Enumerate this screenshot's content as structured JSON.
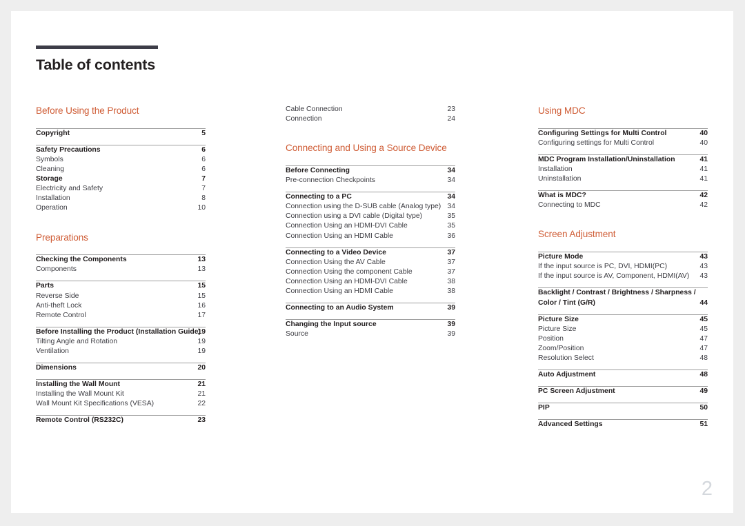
{
  "document": {
    "title": "Table of contents",
    "folio": "2",
    "accent_color": "#cf5c35",
    "rule_color": "#9d9d9d",
    "title_bar_color": "#3d3d48",
    "folio_color": "#d4d8dd"
  },
  "columns": [
    {
      "name": "column-1",
      "blocks": [
        {
          "type": "section-title",
          "text": "Before Using the Product"
        },
        {
          "type": "group",
          "ruled": true,
          "entries": [
            {
              "style": "head",
              "label": "Copyright",
              "page": "5"
            }
          ]
        },
        {
          "type": "spacer",
          "size": "sm"
        },
        {
          "type": "group",
          "ruled": true,
          "entries": [
            {
              "style": "head",
              "label": "Safety Precautions",
              "page": "6"
            },
            {
              "style": "sub",
              "label": "Symbols",
              "page": "6"
            },
            {
              "style": "sub",
              "label": "Cleaning",
              "page": "6"
            },
            {
              "style": "sub bold",
              "label": "Storage",
              "page": "7"
            },
            {
              "style": "sub",
              "label": "Electricity and Safety",
              "page": "7"
            },
            {
              "style": "sub",
              "label": "Installation",
              "page": "8"
            },
            {
              "style": "sub",
              "label": "Operation",
              "page": "10"
            }
          ]
        },
        {
          "type": "spacer",
          "size": "lg"
        },
        {
          "type": "section-title",
          "text": "Preparations"
        },
        {
          "type": "group",
          "ruled": true,
          "entries": [
            {
              "style": "head",
              "label": "Checking the Components",
              "page": "13"
            },
            {
              "style": "sub",
              "label": "Components",
              "page": "13"
            }
          ]
        },
        {
          "type": "spacer",
          "size": "sm"
        },
        {
          "type": "group",
          "ruled": true,
          "entries": [
            {
              "style": "head",
              "label": "Parts",
              "page": "15"
            },
            {
              "style": "sub",
              "label": "Reverse Side",
              "page": "15"
            },
            {
              "style": "sub",
              "label": "Anti-theft Lock",
              "page": "16"
            },
            {
              "style": "sub",
              "label": "Remote Control",
              "page": "17"
            }
          ]
        },
        {
          "type": "spacer",
          "size": "sm"
        },
        {
          "type": "group",
          "ruled": true,
          "entries": [
            {
              "style": "head wrap",
              "label": "Before Installing the Product (Installation Guide)",
              "page": "19"
            },
            {
              "style": "sub",
              "label": "Tilting Angle and Rotation",
              "page": "19"
            },
            {
              "style": "sub",
              "label": "Ventilation",
              "page": "19"
            }
          ]
        },
        {
          "type": "spacer",
          "size": "sm"
        },
        {
          "type": "group",
          "ruled": true,
          "entries": [
            {
              "style": "head",
              "label": "Dimensions",
              "page": "20"
            }
          ]
        },
        {
          "type": "spacer",
          "size": "sm"
        },
        {
          "type": "group",
          "ruled": true,
          "entries": [
            {
              "style": "head",
              "label": "Installing the Wall Mount",
              "page": "21"
            },
            {
              "style": "sub",
              "label": "Installing the Wall Mount Kit",
              "page": "21"
            },
            {
              "style": "sub",
              "label": "Wall Mount Kit Specifications (VESA)",
              "page": "22"
            }
          ]
        },
        {
          "type": "spacer",
          "size": "sm"
        },
        {
          "type": "group",
          "ruled": true,
          "entries": [
            {
              "style": "head",
              "label": "Remote Control (RS232C)",
              "page": "23"
            }
          ]
        }
      ]
    },
    {
      "name": "column-2",
      "blocks": [
        {
          "type": "group",
          "ruled": false,
          "entries": [
            {
              "style": "sub",
              "label": "Cable Connection",
              "page": "23"
            },
            {
              "style": "sub",
              "label": "Connection",
              "page": "24"
            }
          ]
        },
        {
          "type": "spacer",
          "size": "lg"
        },
        {
          "type": "section-title",
          "text": "Connecting and Using a Source Device"
        },
        {
          "type": "group",
          "ruled": true,
          "entries": [
            {
              "style": "head",
              "label": "Before Connecting",
              "page": "34"
            },
            {
              "style": "sub",
              "label": "Pre-connection Checkpoints",
              "page": "34"
            }
          ]
        },
        {
          "type": "spacer",
          "size": "sm"
        },
        {
          "type": "group",
          "ruled": true,
          "entries": [
            {
              "style": "head",
              "label": "Connecting to a PC",
              "page": "34"
            },
            {
              "style": "sub wrap",
              "label": "Connection using the D-SUB cable (Analog type)",
              "page": "34"
            },
            {
              "style": "sub",
              "label": "Connection using a DVI cable (Digital type)",
              "page": "35"
            },
            {
              "style": "sub",
              "label": "Connection Using an HDMI-DVI Cable",
              "page": "35"
            },
            {
              "style": "sub",
              "label": "Connection Using an HDMI Cable",
              "page": "36"
            }
          ]
        },
        {
          "type": "spacer",
          "size": "sm"
        },
        {
          "type": "group",
          "ruled": true,
          "entries": [
            {
              "style": "head",
              "label": "Connecting to a Video Device",
              "page": "37"
            },
            {
              "style": "sub",
              "label": "Connection Using the AV Cable",
              "page": "37"
            },
            {
              "style": "sub",
              "label": "Connection Using the component Cable",
              "page": "37"
            },
            {
              "style": "sub",
              "label": "Connection Using an HDMI-DVI Cable",
              "page": "38"
            },
            {
              "style": "sub",
              "label": "Connection Using an HDMI Cable",
              "page": "38"
            }
          ]
        },
        {
          "type": "spacer",
          "size": "sm"
        },
        {
          "type": "group",
          "ruled": true,
          "entries": [
            {
              "style": "head",
              "label": "Connecting to an Audio System",
              "page": "39"
            }
          ]
        },
        {
          "type": "spacer",
          "size": "sm"
        },
        {
          "type": "group",
          "ruled": true,
          "entries": [
            {
              "style": "head",
              "label": "Changing the Input source",
              "page": "39"
            },
            {
              "style": "sub",
              "label": "Source",
              "page": "39"
            }
          ]
        }
      ]
    },
    {
      "name": "column-3",
      "blocks": [
        {
          "type": "section-title",
          "text": "Using MDC"
        },
        {
          "type": "group",
          "ruled": true,
          "entries": [
            {
              "style": "head",
              "label": "Configuring Settings for Multi Control",
              "page": "40"
            },
            {
              "style": "sub",
              "label": "Configuring settings for Multi Control",
              "page": "40"
            }
          ]
        },
        {
          "type": "spacer",
          "size": "sm"
        },
        {
          "type": "group",
          "ruled": true,
          "entries": [
            {
              "style": "head",
              "label": "MDC Program Installation/Uninstallation",
              "page": "41"
            },
            {
              "style": "sub",
              "label": "Installation",
              "page": "41"
            },
            {
              "style": "sub",
              "label": "Uninstallation",
              "page": "41"
            }
          ]
        },
        {
          "type": "spacer",
          "size": "sm"
        },
        {
          "type": "group",
          "ruled": true,
          "entries": [
            {
              "style": "head",
              "label": "What is MDC?",
              "page": "42"
            },
            {
              "style": "sub",
              "label": "Connecting to MDC",
              "page": "42"
            }
          ]
        },
        {
          "type": "spacer",
          "size": "lg"
        },
        {
          "type": "section-title",
          "text": "Screen Adjustment"
        },
        {
          "type": "group",
          "ruled": true,
          "entries": [
            {
              "style": "head",
              "label": "Picture Mode",
              "page": "43"
            },
            {
              "style": "sub",
              "label": "If the input source is PC, DVI, HDMI(PC)",
              "page": "43"
            },
            {
              "style": "sub wrap",
              "label": "If the input source is AV, Component, HDMI(AV)",
              "page": "43"
            }
          ]
        },
        {
          "type": "spacer",
          "size": "sm"
        },
        {
          "type": "group",
          "ruled": true,
          "entries": [
            {
              "style": "head wrap",
              "label": "Backlight / Contrast / Brightness / Sharpness / Color / Tint (G/R)",
              "page": "44"
            }
          ]
        },
        {
          "type": "spacer",
          "size": "sm"
        },
        {
          "type": "group",
          "ruled": true,
          "entries": [
            {
              "style": "head",
              "label": "Picture Size",
              "page": "45"
            },
            {
              "style": "sub",
              "label": "Picture Size",
              "page": "45"
            },
            {
              "style": "sub",
              "label": "Position",
              "page": "47"
            },
            {
              "style": "sub",
              "label": "Zoom/Position",
              "page": "47"
            },
            {
              "style": "sub",
              "label": "Resolution Select",
              "page": "48"
            }
          ]
        },
        {
          "type": "spacer",
          "size": "sm"
        },
        {
          "type": "group",
          "ruled": true,
          "entries": [
            {
              "style": "head",
              "label": "Auto Adjustment",
              "page": "48"
            }
          ]
        },
        {
          "type": "spacer",
          "size": "sm"
        },
        {
          "type": "group",
          "ruled": true,
          "entries": [
            {
              "style": "head",
              "label": "PC Screen Adjustment",
              "page": "49"
            }
          ]
        },
        {
          "type": "spacer",
          "size": "sm"
        },
        {
          "type": "group",
          "ruled": true,
          "entries": [
            {
              "style": "head",
              "label": "PIP",
              "page": "50"
            }
          ]
        },
        {
          "type": "spacer",
          "size": "sm"
        },
        {
          "type": "group",
          "ruled": true,
          "entries": [
            {
              "style": "head",
              "label": "Advanced Settings",
              "page": "51"
            }
          ]
        }
      ]
    }
  ]
}
